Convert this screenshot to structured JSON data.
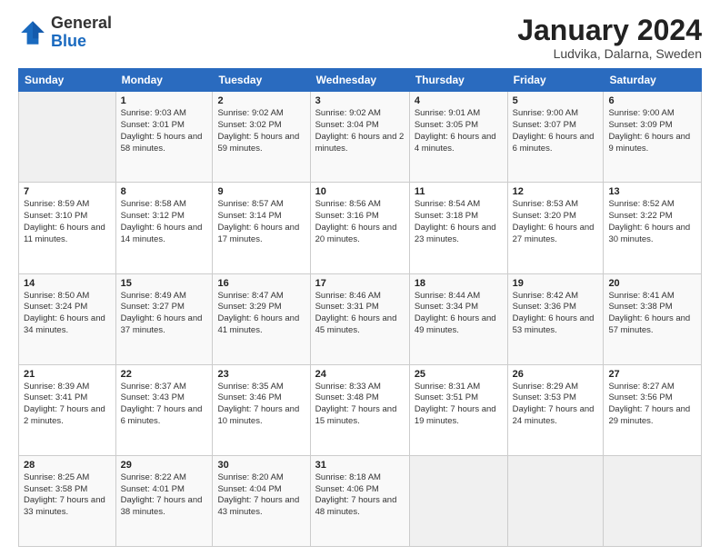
{
  "header": {
    "logo_general": "General",
    "logo_blue": "Blue",
    "month_title": "January 2024",
    "location": "Ludvika, Dalarna, Sweden"
  },
  "weekdays": [
    "Sunday",
    "Monday",
    "Tuesday",
    "Wednesday",
    "Thursday",
    "Friday",
    "Saturday"
  ],
  "weeks": [
    [
      {
        "day": "",
        "info": ""
      },
      {
        "day": "1",
        "info": "Sunrise: 9:03 AM\nSunset: 3:01 PM\nDaylight: 5 hours\nand 58 minutes."
      },
      {
        "day": "2",
        "info": "Sunrise: 9:02 AM\nSunset: 3:02 PM\nDaylight: 5 hours\nand 59 minutes."
      },
      {
        "day": "3",
        "info": "Sunrise: 9:02 AM\nSunset: 3:04 PM\nDaylight: 6 hours\nand 2 minutes."
      },
      {
        "day": "4",
        "info": "Sunrise: 9:01 AM\nSunset: 3:05 PM\nDaylight: 6 hours\nand 4 minutes."
      },
      {
        "day": "5",
        "info": "Sunrise: 9:00 AM\nSunset: 3:07 PM\nDaylight: 6 hours\nand 6 minutes."
      },
      {
        "day": "6",
        "info": "Sunrise: 9:00 AM\nSunset: 3:09 PM\nDaylight: 6 hours\nand 9 minutes."
      }
    ],
    [
      {
        "day": "7",
        "info": "Sunrise: 8:59 AM\nSunset: 3:10 PM\nDaylight: 6 hours\nand 11 minutes."
      },
      {
        "day": "8",
        "info": "Sunrise: 8:58 AM\nSunset: 3:12 PM\nDaylight: 6 hours\nand 14 minutes."
      },
      {
        "day": "9",
        "info": "Sunrise: 8:57 AM\nSunset: 3:14 PM\nDaylight: 6 hours\nand 17 minutes."
      },
      {
        "day": "10",
        "info": "Sunrise: 8:56 AM\nSunset: 3:16 PM\nDaylight: 6 hours\nand 20 minutes."
      },
      {
        "day": "11",
        "info": "Sunrise: 8:54 AM\nSunset: 3:18 PM\nDaylight: 6 hours\nand 23 minutes."
      },
      {
        "day": "12",
        "info": "Sunrise: 8:53 AM\nSunset: 3:20 PM\nDaylight: 6 hours\nand 27 minutes."
      },
      {
        "day": "13",
        "info": "Sunrise: 8:52 AM\nSunset: 3:22 PM\nDaylight: 6 hours\nand 30 minutes."
      }
    ],
    [
      {
        "day": "14",
        "info": "Sunrise: 8:50 AM\nSunset: 3:24 PM\nDaylight: 6 hours\nand 34 minutes."
      },
      {
        "day": "15",
        "info": "Sunrise: 8:49 AM\nSunset: 3:27 PM\nDaylight: 6 hours\nand 37 minutes."
      },
      {
        "day": "16",
        "info": "Sunrise: 8:47 AM\nSunset: 3:29 PM\nDaylight: 6 hours\nand 41 minutes."
      },
      {
        "day": "17",
        "info": "Sunrise: 8:46 AM\nSunset: 3:31 PM\nDaylight: 6 hours\nand 45 minutes."
      },
      {
        "day": "18",
        "info": "Sunrise: 8:44 AM\nSunset: 3:34 PM\nDaylight: 6 hours\nand 49 minutes."
      },
      {
        "day": "19",
        "info": "Sunrise: 8:42 AM\nSunset: 3:36 PM\nDaylight: 6 hours\nand 53 minutes."
      },
      {
        "day": "20",
        "info": "Sunrise: 8:41 AM\nSunset: 3:38 PM\nDaylight: 6 hours\nand 57 minutes."
      }
    ],
    [
      {
        "day": "21",
        "info": "Sunrise: 8:39 AM\nSunset: 3:41 PM\nDaylight: 7 hours\nand 2 minutes."
      },
      {
        "day": "22",
        "info": "Sunrise: 8:37 AM\nSunset: 3:43 PM\nDaylight: 7 hours\nand 6 minutes."
      },
      {
        "day": "23",
        "info": "Sunrise: 8:35 AM\nSunset: 3:46 PM\nDaylight: 7 hours\nand 10 minutes."
      },
      {
        "day": "24",
        "info": "Sunrise: 8:33 AM\nSunset: 3:48 PM\nDaylight: 7 hours\nand 15 minutes."
      },
      {
        "day": "25",
        "info": "Sunrise: 8:31 AM\nSunset: 3:51 PM\nDaylight: 7 hours\nand 19 minutes."
      },
      {
        "day": "26",
        "info": "Sunrise: 8:29 AM\nSunset: 3:53 PM\nDaylight: 7 hours\nand 24 minutes."
      },
      {
        "day": "27",
        "info": "Sunrise: 8:27 AM\nSunset: 3:56 PM\nDaylight: 7 hours\nand 29 minutes."
      }
    ],
    [
      {
        "day": "28",
        "info": "Sunrise: 8:25 AM\nSunset: 3:58 PM\nDaylight: 7 hours\nand 33 minutes."
      },
      {
        "day": "29",
        "info": "Sunrise: 8:22 AM\nSunset: 4:01 PM\nDaylight: 7 hours\nand 38 minutes."
      },
      {
        "day": "30",
        "info": "Sunrise: 8:20 AM\nSunset: 4:04 PM\nDaylight: 7 hours\nand 43 minutes."
      },
      {
        "day": "31",
        "info": "Sunrise: 8:18 AM\nSunset: 4:06 PM\nDaylight: 7 hours\nand 48 minutes."
      },
      {
        "day": "",
        "info": ""
      },
      {
        "day": "",
        "info": ""
      },
      {
        "day": "",
        "info": ""
      }
    ]
  ]
}
